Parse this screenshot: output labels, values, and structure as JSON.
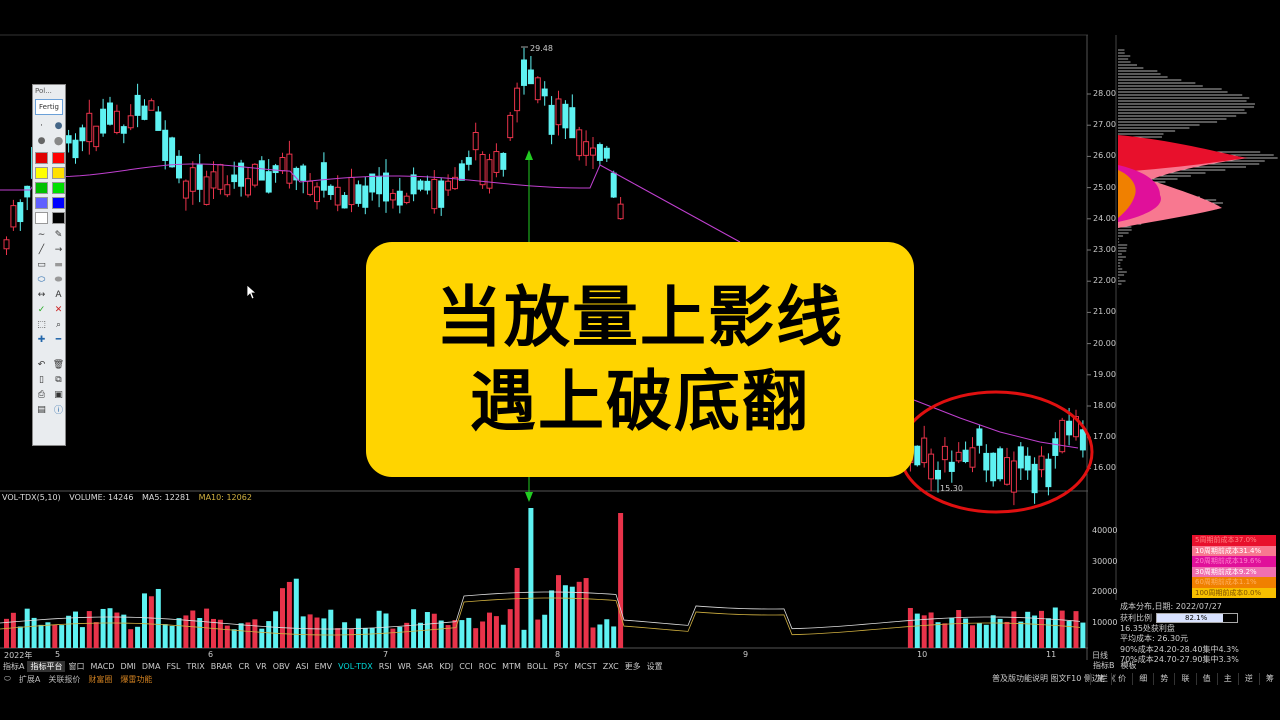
{
  "overlay": {
    "line1": "当放量上影线",
    "line2": "遇上破底翻"
  },
  "toolbar": {
    "title": "Pol...",
    "font_label": "Fertig",
    "colors": [
      "#e00000",
      "#ff0000",
      "#ffff00",
      "#ffe000",
      "#00c000",
      "#00e000",
      "#6060ff",
      "#0000ff",
      "#ffffff",
      "#000000"
    ]
  },
  "price_axis": [
    "28.00",
    "27.00",
    "26.00",
    "25.00",
    "24.00",
    "23.00",
    "22.00",
    "21.00",
    "20.00",
    "19.00",
    "18.00",
    "17.00",
    "16.00"
  ],
  "volume_axis": [
    "40000",
    "30000",
    "20000",
    "10000"
  ],
  "annotations": {
    "high": "29.48",
    "low": "15.30"
  },
  "x_axis": {
    "year": "2022年",
    "months": [
      "5",
      "6",
      "7",
      "8",
      "9",
      "10",
      "11"
    ],
    "right_tab": "日线"
  },
  "volume_header": {
    "indicator": "VOL-TDX(5,10)",
    "volume": "VOLUME: 14246",
    "ma5": "MA5: 12281",
    "ma10": "MA10: 12062"
  },
  "colors": {
    "up": "#e8334a",
    "down": "#5ef2f2",
    "ma": "#c040d0",
    "ma10": "#d0b040",
    "overlay": "#ffd400",
    "circle": "#e01010"
  },
  "menu": [
    "指标A",
    "指标平台",
    "窗口",
    "MACD",
    "DMI",
    "DMA",
    "FSL",
    "TRIX",
    "BRAR",
    "CR",
    "VR",
    "OBV",
    "ASI",
    "EMV",
    "VOL-TDX",
    "RSI",
    "WR",
    "SAR",
    "KDJ",
    "CCI",
    "ROC",
    "MTM",
    "BOLL",
    "PSY",
    "MCST",
    "ZXC",
    "更多",
    "设置"
  ],
  "menu_active": "VOL-TDX",
  "menu2": [
    "扩展A",
    "关联报价",
    "财富圈",
    "爆雷功能"
  ],
  "bottom_right_text": "普及版功能说明 图文F10 侧边栏《",
  "right_tabs": [
    "指标B",
    "模板"
  ],
  "right_menu": [
    "笔",
    "价",
    "细",
    "势",
    "联",
    "值",
    "主",
    "逆",
    "筹"
  ],
  "chip_legend": [
    {
      "label": "5周期前成本37.0%",
      "bg": "#e8102c",
      "fg": "#ff8080"
    },
    {
      "label": "10周期前成本31.4%",
      "bg": "#f87890",
      "fg": "#ffffff"
    },
    {
      "label": "20周期前成本19.6%",
      "bg": "#e0109a",
      "fg": "#ff80d0"
    },
    {
      "label": "30周期前成本9.2%",
      "bg": "#f070b0",
      "fg": "#ffffff"
    },
    {
      "label": "60周期前成本1.1%",
      "bg": "#f08000",
      "fg": "#ffb060"
    },
    {
      "label": "100周期前成本0.0%",
      "bg": "#f8c000",
      "fg": "#805000"
    }
  ],
  "chip_info": {
    "date": "成本分布,日期:  2022/07/27",
    "ratio_label": "获利比例",
    "ratio": "82.1%",
    "ratio_value": 0.821,
    "profit": "16.35处获利盘",
    "avg": "平均成本:  26.30元",
    "c90": "90%成本24.20-28.40集中4.3%",
    "c70": "70%成本24.70-27.90集中3.3%"
  }
}
